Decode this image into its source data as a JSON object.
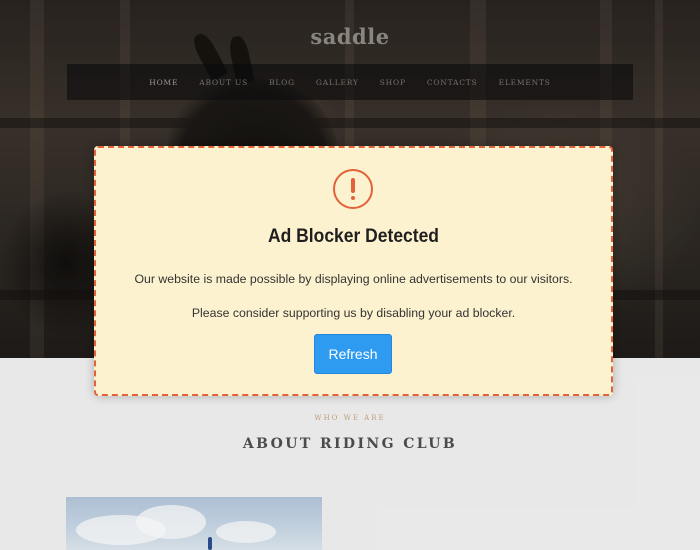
{
  "site": {
    "logo": "saddle",
    "nav": [
      {
        "label": "HOME",
        "active": true
      },
      {
        "label": "ABOUT US",
        "active": false
      },
      {
        "label": "BLOG",
        "active": false
      },
      {
        "label": "GALLERY",
        "active": false
      },
      {
        "label": "SHOP",
        "active": false
      },
      {
        "label": "CONTACTS",
        "active": false
      },
      {
        "label": "ELEMENTS",
        "active": false
      }
    ]
  },
  "section": {
    "subheading": "WHO WE ARE",
    "title": "ABOUT RIDING CLUB"
  },
  "modal": {
    "icon": "exclamation-circle-icon",
    "title": "Ad Blocker Detected",
    "body": "Our website is made possible by displaying online advertisements to our visitors. Please consider supporting us by disabling your ad blocker.",
    "button_label": "Refresh"
  },
  "colors": {
    "modal_background": "#fdf2cf",
    "modal_border_accent": "#e2623a",
    "button_blue": "#2f9bf0",
    "subheading_gold": "#c9a583"
  }
}
